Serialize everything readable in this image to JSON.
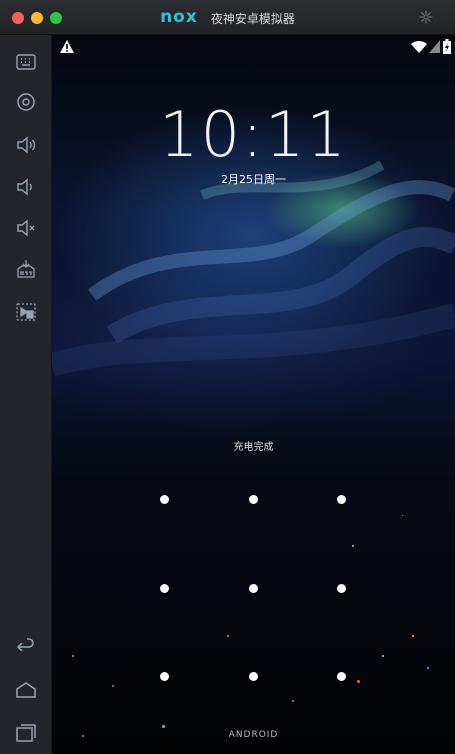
{
  "window": {
    "logo_text": "nox",
    "title": "夜神安卓模拟器"
  },
  "sidebar": {
    "items": [
      {
        "icon": "keyboard-icon"
      },
      {
        "icon": "location-icon"
      },
      {
        "icon": "volume-up-icon"
      },
      {
        "icon": "volume-down-icon"
      },
      {
        "icon": "mute-icon"
      },
      {
        "icon": "apk-install-icon"
      },
      {
        "icon": "screen-record-icon"
      },
      {
        "icon": "back-icon"
      },
      {
        "icon": "home-icon"
      },
      {
        "icon": "recent-apps-icon"
      }
    ]
  },
  "lockscreen": {
    "time": "10:11",
    "date": "2月25日周一",
    "charging_status": "充电完成",
    "footer": "ANDROID"
  },
  "colors": {
    "accent": "#2fc3d7",
    "titlebar": "#24252a",
    "screen_top": "#0a1430"
  }
}
